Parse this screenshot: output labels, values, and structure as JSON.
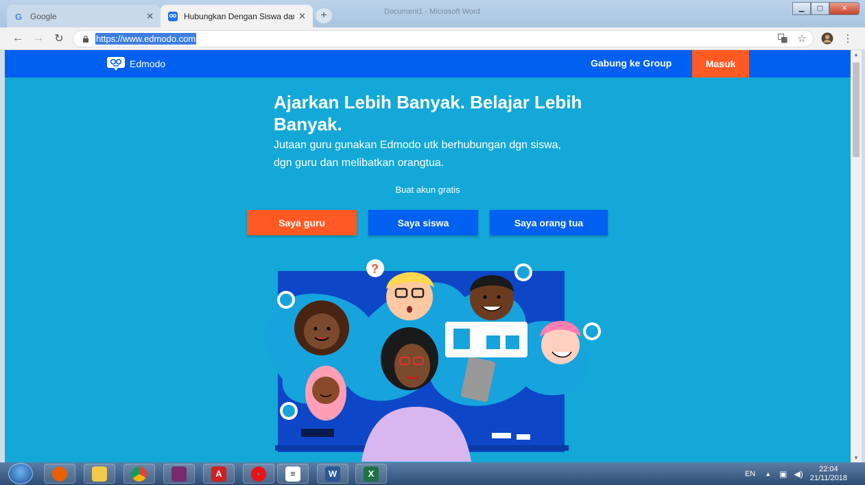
{
  "browser": {
    "tabs": [
      {
        "title": "Google",
        "active": false
      },
      {
        "title": "Hubungkan Dengan Siswa dan O",
        "active": true
      }
    ],
    "background_window_title": "Document1 - Microsoft Word",
    "url": "https://www.edmodo.com"
  },
  "site": {
    "brand": "Edmodo",
    "nav": {
      "join_group": "Gabung ke Group",
      "login": "Masuk"
    },
    "hero": {
      "title": "Ajarkan Lebih Banyak. Belajar Lebih Banyak.",
      "subtitle": "Jutaan guru gunakan Edmodo utk berhubungan dgn siswa, dgn guru dan melibatkan orangtua.",
      "cta": "Buat akun gratis"
    },
    "buttons": {
      "teacher": "Saya guru",
      "student": "Saya siswa",
      "parent": "Saya orang tua"
    },
    "colors": {
      "nav_blue": "#0060f0",
      "hero_bg": "#13a8d7",
      "accent_orange": "#ff5a24"
    }
  },
  "taskbar": {
    "apps": [
      "firefox-icon",
      "explorer-icon",
      "chrome-icon",
      "winrar-icon",
      "acrobat-icon",
      "opera-icon",
      "notepad-icon",
      "word-icon",
      "excel-icon"
    ],
    "language": "EN",
    "time": "22:04",
    "date": "21/11/2018"
  }
}
